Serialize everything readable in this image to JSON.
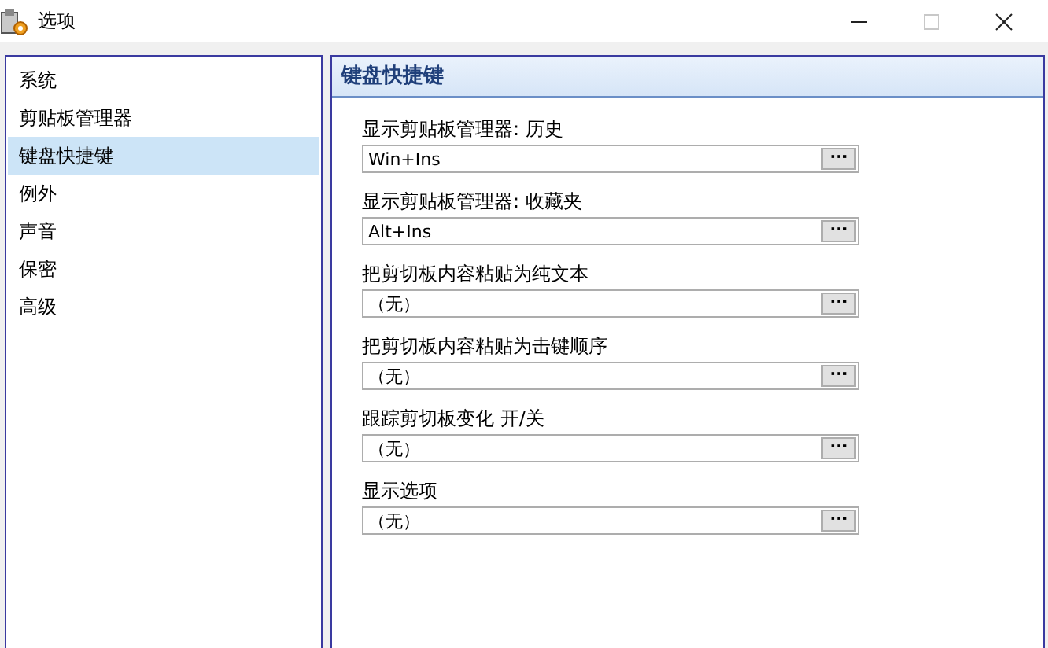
{
  "window": {
    "title": "选项",
    "maximize_disabled": true
  },
  "sidebar": {
    "items": [
      {
        "label": "系统",
        "selected": false
      },
      {
        "label": "剪贴板管理器",
        "selected": false
      },
      {
        "label": "键盘快捷键",
        "selected": true
      },
      {
        "label": "例外",
        "selected": false
      },
      {
        "label": "声音",
        "selected": false
      },
      {
        "label": "保密",
        "selected": false
      },
      {
        "label": "高级",
        "selected": false
      }
    ]
  },
  "panel": {
    "title": "键盘快捷键",
    "shortcuts": [
      {
        "label": "显示剪贴板管理器: 历史",
        "value": "Win+Ins",
        "button": "···"
      },
      {
        "label": "显示剪贴板管理器: 收藏夹",
        "value": "Alt+Ins",
        "button": "···"
      },
      {
        "label": "把剪切板内容粘贴为纯文本",
        "value": "（无）",
        "button": "···"
      },
      {
        "label": "把剪切板内容粘贴为击键顺序",
        "value": "（无）",
        "button": "···"
      },
      {
        "label": "跟踪剪切板变化 开/关",
        "value": "（无）",
        "button": "···"
      },
      {
        "label": "显示选项",
        "value": "（无）",
        "button": "···"
      }
    ]
  }
}
